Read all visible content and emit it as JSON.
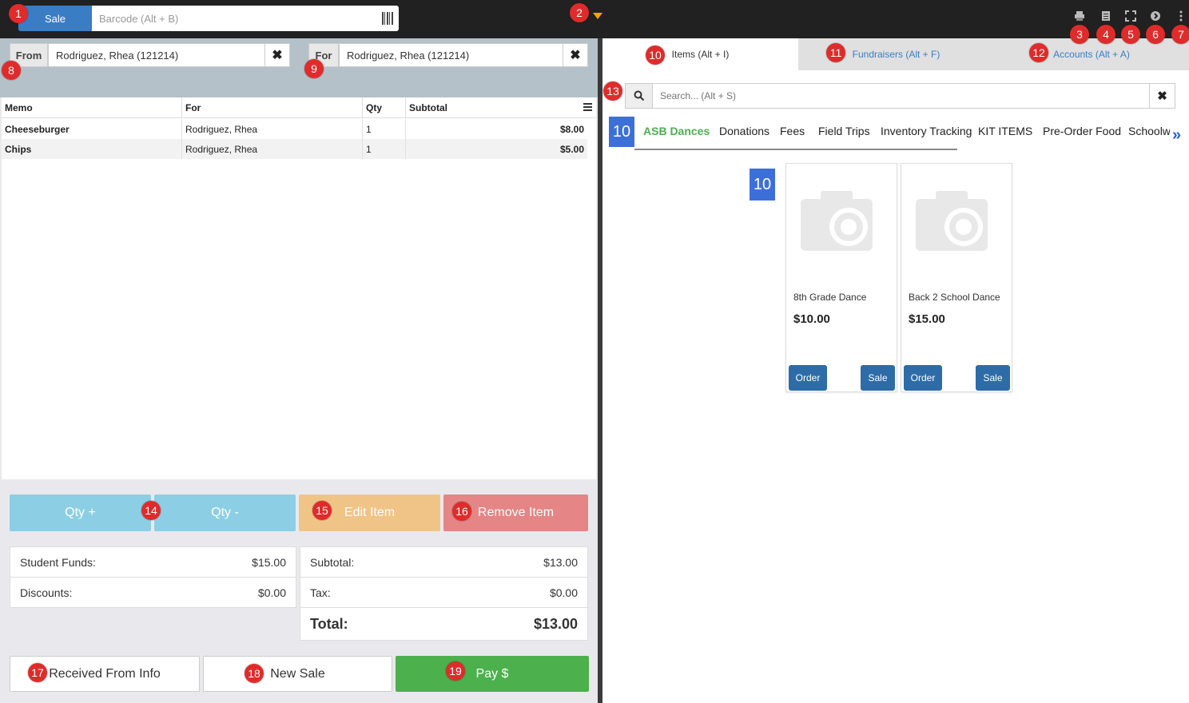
{
  "topbar": {
    "sale_label": "Sale",
    "barcode_placeholder": "Barcode (Alt + B)",
    "icons": [
      "printer-icon",
      "document-icon",
      "fullscreen-icon",
      "circle-arrow-icon",
      "more-vert-icon"
    ],
    "caret_color": "#f0a500"
  },
  "customer": {
    "from_label": "From",
    "from_value": "Rodriguez, Rhea (121214)",
    "for_label": "For",
    "for_value": "Rodriguez, Rhea (121214)",
    "clear_glyph": "✖"
  },
  "table": {
    "headers": [
      "Memo",
      "For",
      "Qty",
      "Subtotal"
    ],
    "rows": [
      {
        "memo": "Cheeseburger",
        "for": "Rodriguez, Rhea",
        "qty": "1",
        "subtotal": "$8.00"
      },
      {
        "memo": "Chips",
        "for": "Rodriguez, Rhea",
        "qty": "1",
        "subtotal": "$5.00"
      }
    ]
  },
  "actions": {
    "qty_plus": "Qty +",
    "qty_minus": "Qty -",
    "edit_item": "Edit Item",
    "remove_item": "Remove Item"
  },
  "summary_left": [
    {
      "label": "Student Funds:",
      "value": "$15.00"
    },
    {
      "label": "Discounts:",
      "value": "$0.00"
    }
  ],
  "summary_right": {
    "subtotal_label": "Subtotal:",
    "subtotal_value": "$13.00",
    "tax_label": "Tax:",
    "tax_value": "$0.00",
    "total_label": "Total:",
    "total_value": "$13.00"
  },
  "bottom": {
    "received_from": "Received From Info",
    "new_sale": "New Sale",
    "pay": "Pay $"
  },
  "right_tabs": [
    "Items (Alt + I)",
    "Fundraisers (Alt + F)",
    "Accounts (Alt + A)"
  ],
  "search": {
    "placeholder": "Search... (Alt + S)"
  },
  "categories": [
    "ASB Dances",
    "Donations",
    "Fees",
    "Field Trips",
    "Inventory Tracking",
    "KIT ITEMS",
    "Pre-Order Food",
    "Schoolw"
  ],
  "more_glyph": "»",
  "items": [
    {
      "name": "8th Grade Dance",
      "price": "$10.00",
      "order_label": "Order",
      "sale_label": "Sale"
    },
    {
      "name": "Back 2 School Dance",
      "price": "$15.00",
      "order_label": "Order",
      "sale_label": "Sale"
    }
  ],
  "badges": [
    "1",
    "2",
    "3",
    "4",
    "5",
    "6",
    "7",
    "8",
    "9",
    "10",
    "11",
    "12",
    "13",
    "14",
    "15",
    "16",
    "17",
    "18",
    "19"
  ],
  "colors": {
    "primary": "#3a7dc4",
    "info": "#8ccfe4",
    "warning": "#f0c487",
    "danger": "#e58585",
    "success": "#4cb04c",
    "active_category": "#4caf50",
    "tab_link": "#3a7dc4"
  }
}
